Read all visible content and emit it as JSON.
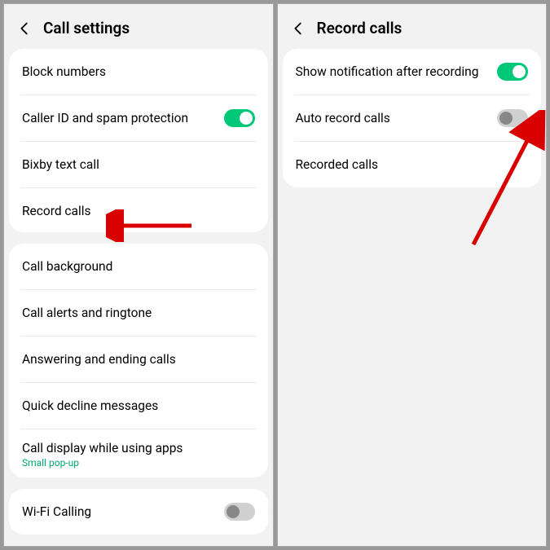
{
  "left": {
    "title": "Call settings",
    "group1": {
      "block_numbers": "Block numbers",
      "caller_id": "Caller ID and spam protection",
      "bixby": "Bixby text call",
      "record_calls": "Record calls"
    },
    "group2": {
      "call_background": "Call background",
      "call_alerts": "Call alerts and ringtone",
      "answering": "Answering and ending calls",
      "quick_decline": "Quick decline messages",
      "call_display": "Call display while using apps",
      "call_display_sub": "Small pop-up"
    },
    "group3": {
      "wifi_calling": "Wi-Fi Calling"
    }
  },
  "right": {
    "title": "Record calls",
    "show_notification": "Show notification after recording",
    "auto_record": "Auto record calls",
    "recorded_calls": "Recorded calls"
  }
}
